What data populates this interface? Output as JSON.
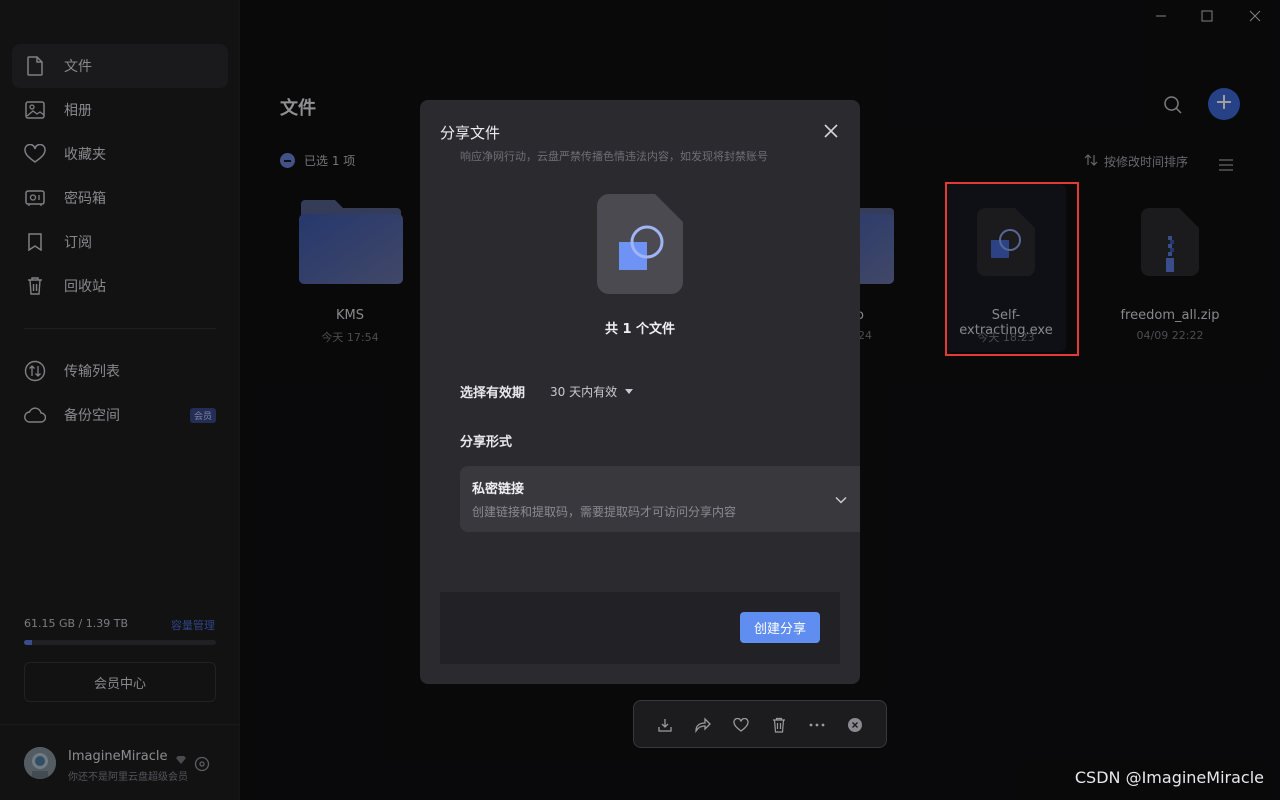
{
  "sidebar": {
    "items": [
      {
        "label": "文件",
        "icon": "file-icon"
      },
      {
        "label": "相册",
        "icon": "photo-icon"
      },
      {
        "label": "收藏夹",
        "icon": "heart-icon"
      },
      {
        "label": "密码箱",
        "icon": "safe-icon"
      },
      {
        "label": "订阅",
        "icon": "bookmark-icon"
      },
      {
        "label": "回收站",
        "icon": "trash-icon"
      },
      {
        "label": "传输列表",
        "icon": "transfer-icon"
      },
      {
        "label": "备份空间",
        "icon": "cloud-icon",
        "badge": "会员"
      }
    ],
    "storage": {
      "text": "61.15 GB / 1.39 TB",
      "link": "容量管理",
      "used_fraction": 0.043
    },
    "vip_button": "会员中心",
    "user": {
      "name": "ImagineMiracle",
      "subtitle": "你还不是阿里云盘超级会员"
    }
  },
  "main": {
    "title": "文件",
    "selection": "已选 1 项",
    "sort": "按修改时间排序",
    "files": [
      {
        "name": "KMS",
        "date": "今天 17:54",
        "type": "folder"
      },
      {
        "name": "o",
        "date": "24",
        "type": "folder"
      },
      {
        "name": "Self-extracting.exe",
        "date": "今天 18:23",
        "type": "exe",
        "selected": true
      },
      {
        "name": "freedom_all.zip",
        "date": "04/09 22:22",
        "type": "zip"
      }
    ]
  },
  "modal": {
    "title": "分享文件",
    "subtitle": "响应净网行动，云盘严禁传播色情违法内容，如发现将封禁账号",
    "count": "共 1 个文件",
    "expiry_label": "选择有效期",
    "expiry_value": "30 天内有效",
    "form_label": "分享形式",
    "card_title": "私密链接",
    "card_desc": "创建链接和提取码，需要提取码才可访问分享内容",
    "create_button": "创建分享"
  },
  "watermark": "CSDN @ImagineMiracle",
  "colors": {
    "accent": "#5f8df0",
    "highlight": "#e23b36"
  }
}
